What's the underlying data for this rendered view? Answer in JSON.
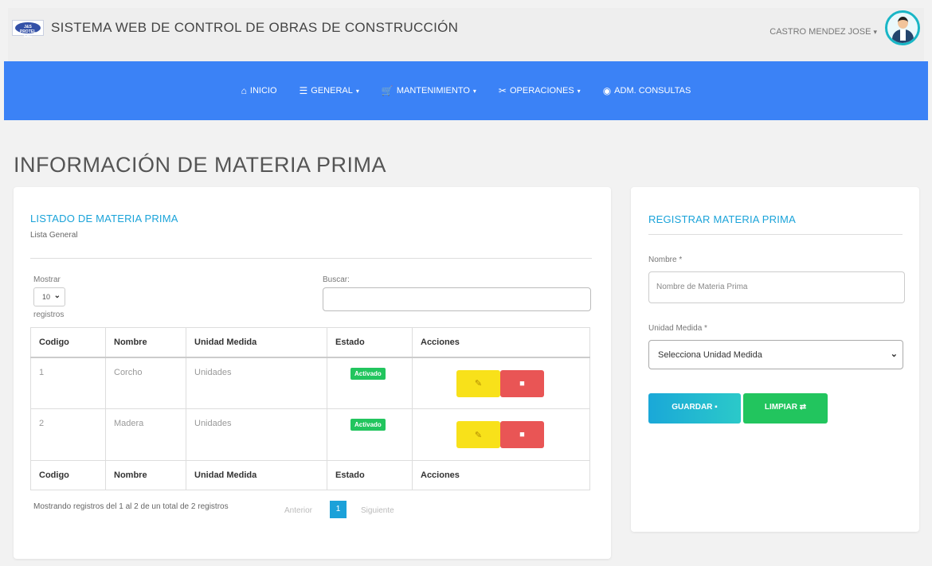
{
  "header": {
    "logo_text": "J&S PROTEL SAC",
    "app_title": "SISTEMA WEB DE CONTROL DE OBRAS DE CONSTRUCCIÓN",
    "user_name": "CASTRO MENDEZ JOSE",
    "user_caret": "▾"
  },
  "nav": {
    "items": [
      {
        "label": "INICIO",
        "icon": "home-icon",
        "glyph": "⌂"
      },
      {
        "label": "GENERAL",
        "icon": "list-add-icon",
        "glyph": "☰",
        "caret": "▾"
      },
      {
        "label": "MANTENIMIENTO",
        "icon": "cart-icon",
        "glyph": "🛒",
        "caret": "▾"
      },
      {
        "label": "OPERACIONES",
        "icon": "tools-icon",
        "glyph": "✂",
        "caret": "▾"
      },
      {
        "label": "ADM. CONSULTAS",
        "icon": "eye-icon",
        "glyph": "◉"
      }
    ]
  },
  "page": {
    "title": "INFORMACIÓN DE MATERIA PRIMA"
  },
  "listing": {
    "title": "LISTADO DE MATERIA PRIMA",
    "subtitle": "Lista General",
    "show_label": "Mostrar",
    "page_size": "10",
    "records_label": "registros",
    "search_label": "Buscar:",
    "search_value": "",
    "columns": [
      "Codigo",
      "Nombre",
      "Unidad Medida",
      "Estado",
      "Acciones"
    ],
    "rows": [
      {
        "codigo": "1",
        "nombre": "Corcho",
        "unidad": "Unidades",
        "estado": "Activado"
      },
      {
        "codigo": "2",
        "nombre": "Madera",
        "unidad": "Unidades",
        "estado": "Activado"
      }
    ],
    "info": "Mostrando registros del 1 al 2 de un total de 2 registros",
    "pagination": {
      "prev": "Anterior",
      "current": "1",
      "next": "Siguiente"
    }
  },
  "form": {
    "title": "REGISTRAR MATERIA PRIMA",
    "name_label": "Nombre *",
    "name_placeholder": "Nombre de Materia Prima",
    "unit_label": "Unidad Medida *",
    "unit_selected": "Selecciona Unidad Medida",
    "save_label": "GUARDAR",
    "clear_label": "LIMPIAR"
  },
  "colors": {
    "nav_bg": "#3b82f6",
    "accent": "#1aa3d9",
    "badge_green": "#22c55e",
    "edit_yellow": "#f8e11a",
    "delete_red": "#e95555"
  }
}
